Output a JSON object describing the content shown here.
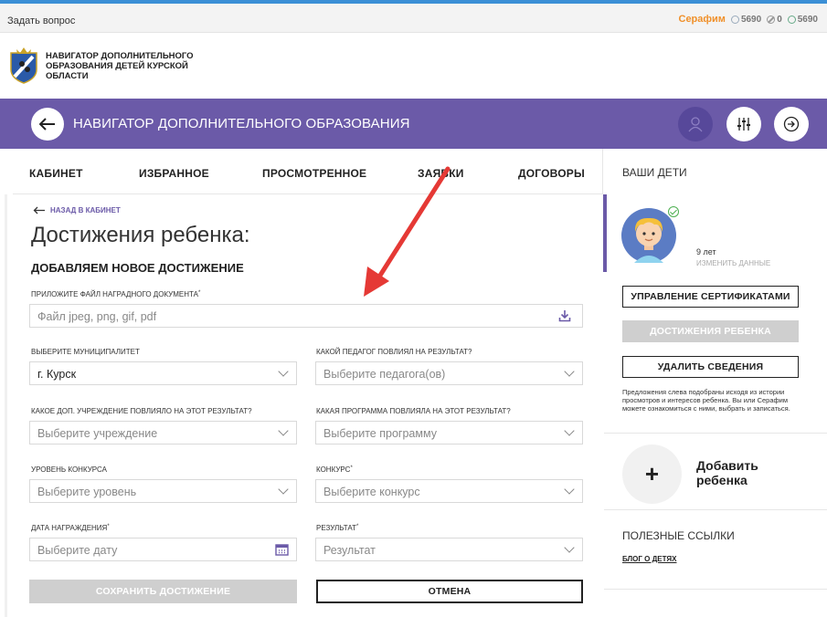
{
  "topbar": {
    "ask_question": "Задать вопрос",
    "user_name": "Серафим",
    "points_total": "5690",
    "points_blocked": "0",
    "points_pending": "5690"
  },
  "branding": {
    "logo_text": "НАВИГАТОР ДОПОЛНИТЕЛЬНОГО ОБРАЗОВАНИЯ ДЕТЕЙ КУРСКОЙ ОБЛАСТИ"
  },
  "navbar": {
    "title": "НАВИГАТОР ДОПОЛНИТЕЛЬНОГО ОБРАЗОВАНИЯ",
    "accent_color": "#6b5aa8"
  },
  "tabs": [
    "КАБИНЕТ",
    "ИЗБРАННОЕ",
    "ПРОСМОТРЕННОЕ",
    "ЗАЯВКИ",
    "ДОГОВОРЫ"
  ],
  "main": {
    "back_link": "НАЗАД В КАБИНЕТ",
    "title": "Достижения ребенка:",
    "subtitle": "ДОБАВЛЯЕМ НОВОЕ ДОСТИЖЕНИЕ",
    "file": {
      "label": "ПРИЛОЖИТЕ ФАЙЛ НАГРАДНОГО ДОКУМЕНТА",
      "placeholder": "Файл jpeg, png, gif, pdf"
    },
    "municipality": {
      "label": "ВЫБЕРИТЕ МУНИЦИПАЛИТЕТ",
      "value": "г. Курск"
    },
    "teacher": {
      "label": "КАКОЙ ПЕДАГОГ ПОВЛИЯЛ НА РЕЗУЛЬТАТ?",
      "placeholder": "Выберите педагога(ов)"
    },
    "institution": {
      "label": "КАКОЕ ДОП. УЧРЕЖДЕНИЕ ПОВЛИЯЛО НА ЭТОТ РЕЗУЛЬТАТ?",
      "placeholder": "Выберите учреждение"
    },
    "program": {
      "label": "КАКАЯ ПРОГРАММА ПОВЛИЯЛА НА ЭТОТ РЕЗУЛЬТАТ?",
      "placeholder": "Выберите программу"
    },
    "level": {
      "label": "УРОВЕНЬ КОНКУРСА",
      "placeholder": "Выберите уровень"
    },
    "contest": {
      "label": "КОНКУРС",
      "placeholder": "Выберите конкурс"
    },
    "date": {
      "label": "ДАТА НАГРАЖДЕНИЯ",
      "placeholder": "Выберите дату"
    },
    "result": {
      "label": "РЕЗУЛЬТАТ",
      "placeholder": "Результат"
    },
    "save_label": "СОХРАНИТЬ ДОСТИЖЕНИЕ",
    "cancel_label": "ОТМЕНА",
    "required_mark": "*"
  },
  "sidebar": {
    "title": "ВАШИ ДЕТИ",
    "child_age": "9 лет",
    "edit_data": "ИЗМЕНИТЬ ДАННЫЕ",
    "certificates": "УПРАВЛЕНИЕ СЕРТИФИКАТАМИ",
    "achievements": "ДОСТИЖЕНИЯ РЕБЕНКА",
    "delete": "УДАЛИТЬ СВЕДЕНИЯ",
    "note": "Предложения слева подобраны исходя из истории просмотров и интересов ребенка. Вы или Серафим можете ознакомиться с ними, выбрать и записаться.",
    "add_child_plus": "+",
    "add_child": "Добавить ребенка",
    "useful_links": "ПОЛЕЗНЫЕ ССЫЛКИ",
    "blog": "БЛОГ О ДЕТЯХ"
  }
}
